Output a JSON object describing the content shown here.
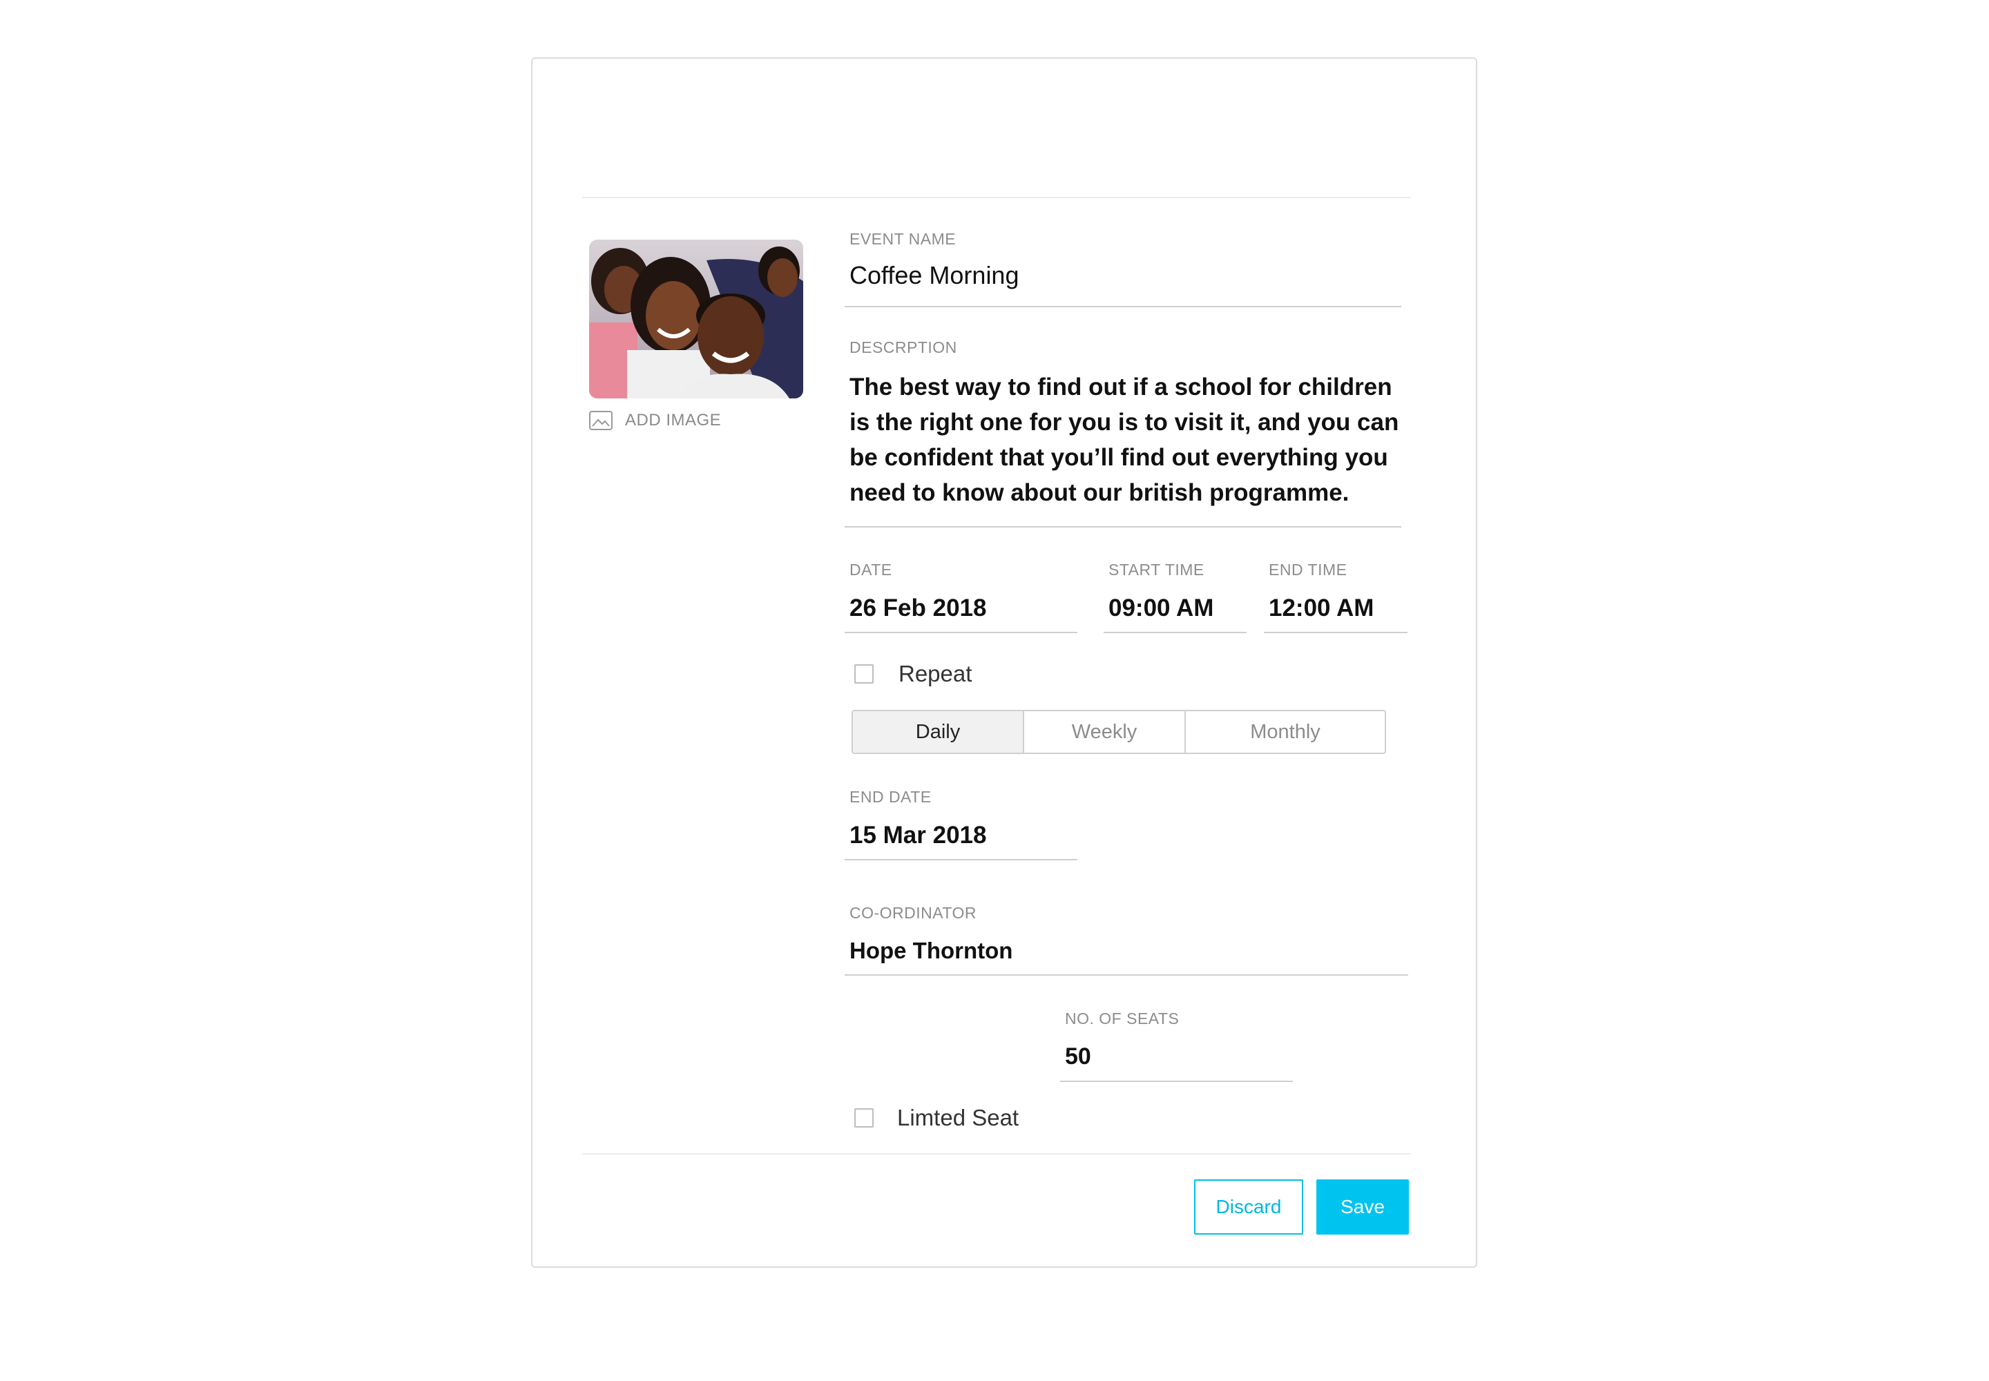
{
  "form": {
    "event_name": {
      "label": "EVENT NAME",
      "value": "Coffee Morning"
    },
    "description": {
      "label": "DESCRPTION",
      "value": "The best way to find out if a school for children is the right one for you is to visit it, and you can be confident that you’ll find out everything you need to know about our british programme."
    },
    "date": {
      "label": "DATE",
      "value": "26 Feb 2018"
    },
    "start_time": {
      "label": "START TIME",
      "value": "09:00 AM"
    },
    "end_time": {
      "label": "END TIME",
      "value": "12:00 AM"
    },
    "repeat": {
      "label": "Repeat",
      "checked": false
    },
    "frequency": {
      "options": [
        "Daily",
        "Weekly",
        "Monthly"
      ],
      "selected": "Daily"
    },
    "end_date": {
      "label": "END DATE",
      "value": "15 Mar 2018"
    },
    "coordinator": {
      "label": "CO-ORDINATOR",
      "value": "Hope Thornton"
    },
    "limited_seat": {
      "label": "Limted Seat",
      "checked": false
    },
    "seats": {
      "label": "NO. OF SEATS",
      "value": "50"
    }
  },
  "image": {
    "add_label": "ADD IMAGE",
    "icon": "image-icon"
  },
  "actions": {
    "discard": "Discard",
    "save": "Save"
  },
  "colors": {
    "accent": "#00c4ef",
    "label": "#8c8c8c",
    "border": "#dcdcdc"
  }
}
